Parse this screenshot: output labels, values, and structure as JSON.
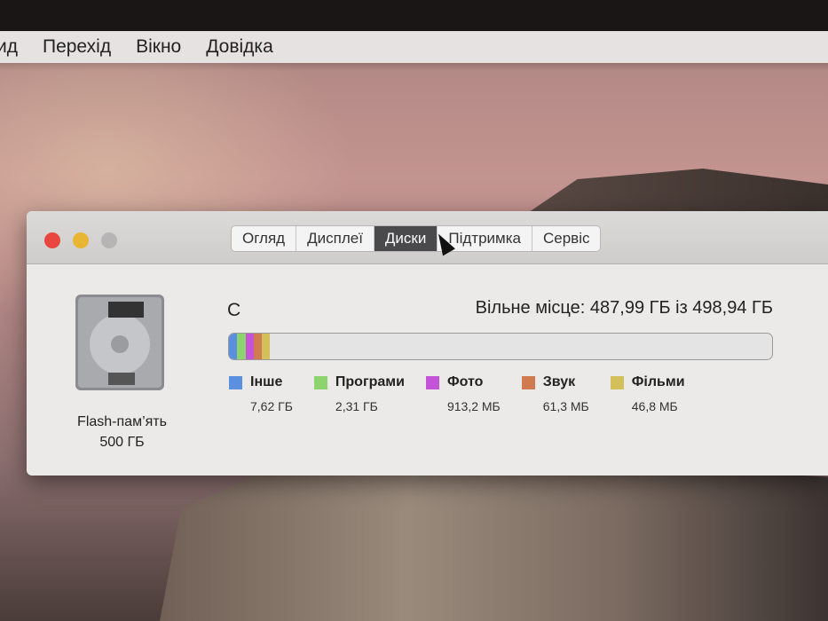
{
  "menubar": {
    "items": [
      "ид",
      "Перехід",
      "Вікно",
      "Довідка"
    ]
  },
  "window": {
    "tabs": [
      {
        "label": "Огляд"
      },
      {
        "label": "Дисплеї"
      },
      {
        "label": "Диски",
        "active": true
      },
      {
        "label": "Підтримка"
      },
      {
        "label": "Сервіс"
      }
    ],
    "disk": {
      "name": "Flash-пам’ять",
      "size": "500 ГБ",
      "volume": "С",
      "free_text": "Вільне місце: 487,99 ГБ із 498,94 ГБ"
    },
    "legend": [
      {
        "label": "Інше",
        "value": "7,62 ГБ",
        "color": "#5b8fe0"
      },
      {
        "label": "Програми",
        "value": "2,31 ГБ",
        "color": "#8ed46e"
      },
      {
        "label": "Фото",
        "value": "913,2 МБ",
        "color": "#c453d8"
      },
      {
        "label": "Звук",
        "value": "61,3 МБ",
        "color": "#d07a50"
      },
      {
        "label": "Фільми",
        "value": "46,8 МБ",
        "color": "#d4c05a"
      }
    ],
    "usage_gb": [
      7.62,
      2.31,
      0.9132,
      0.0613,
      0.0468
    ],
    "total_gb": 498.94
  }
}
